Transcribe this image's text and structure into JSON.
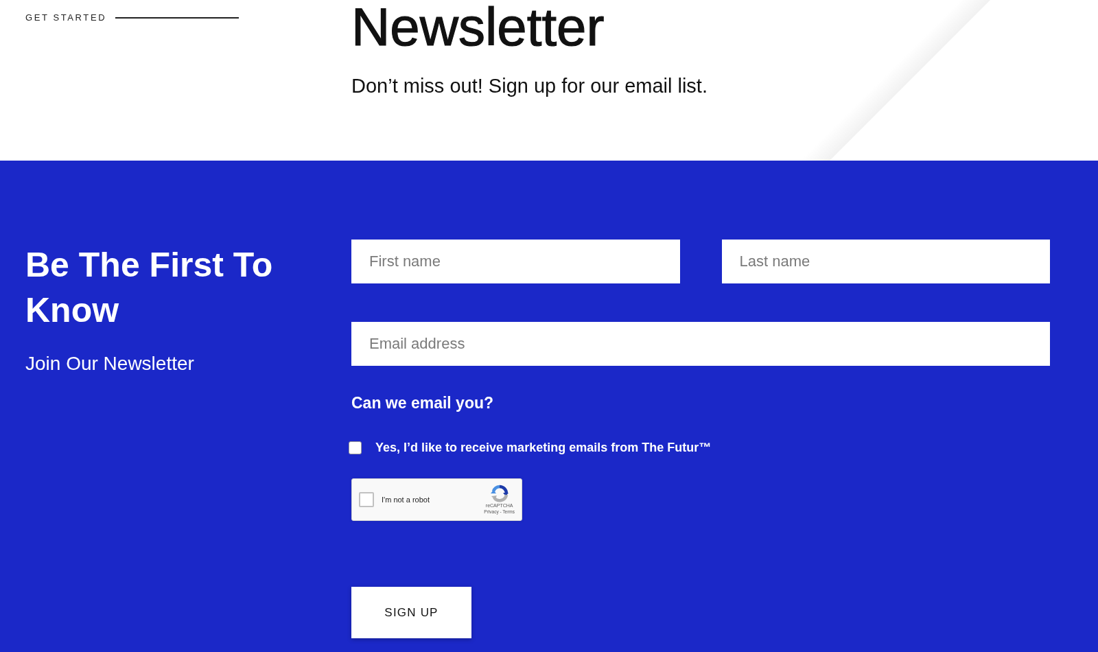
{
  "header": {
    "eyebrow": "GET STARTED",
    "title": "Newsletter",
    "subtitle": "Don’t miss out! Sign up for our email list."
  },
  "signup": {
    "title": "Be The First To Know",
    "subtitle": "Join Our Newsletter",
    "name_fields": [
      {
        "placeholder": "First name"
      },
      {
        "placeholder": "Last name"
      }
    ],
    "email_field": {
      "placeholder": "Email address"
    },
    "consent": {
      "question": "Can we email you?",
      "label": "Yes, I’d like to receive marketing emails from The Futur™",
      "checked": false
    },
    "captcha": {
      "label": "I'm not a robot",
      "checked": false,
      "brand": "reCAPTCHA",
      "footer": "Privacy - Terms"
    },
    "button": "SIGN UP"
  }
}
